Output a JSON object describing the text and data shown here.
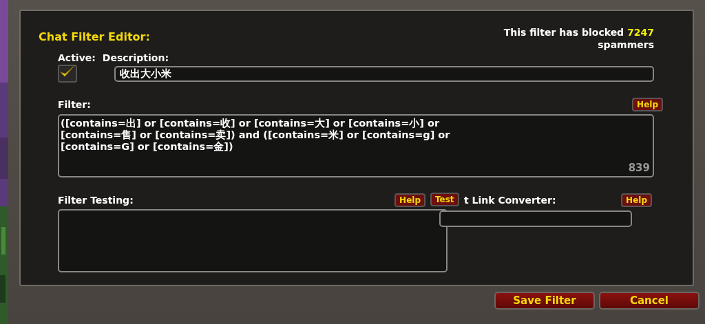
{
  "title": "Chat Filter Editor:",
  "blocked": {
    "prefix": "This filter has blocked",
    "count": "7247",
    "suffix": "spammers"
  },
  "active": {
    "label": "Active:",
    "checked": true
  },
  "description": {
    "label": "Description:",
    "value": "收出大小米"
  },
  "filter": {
    "label": "Filter:",
    "help": "Help",
    "value_lines": [
      "([contains=出] or [contains=收] or [contains=大] or [contains=小] or",
      "[contains=售] or [contains=卖]) and ([contains=米] or [contains=g] or",
      "[contains=G] or [contains=金])"
    ],
    "counter": "839"
  },
  "filter_testing": {
    "label": "Filter Testing:",
    "help": "Help",
    "test": "Test"
  },
  "link_converter": {
    "label": "t Link Converter:",
    "help": "Help"
  },
  "buttons": [
    "Save Filter",
    "Cancel"
  ]
}
